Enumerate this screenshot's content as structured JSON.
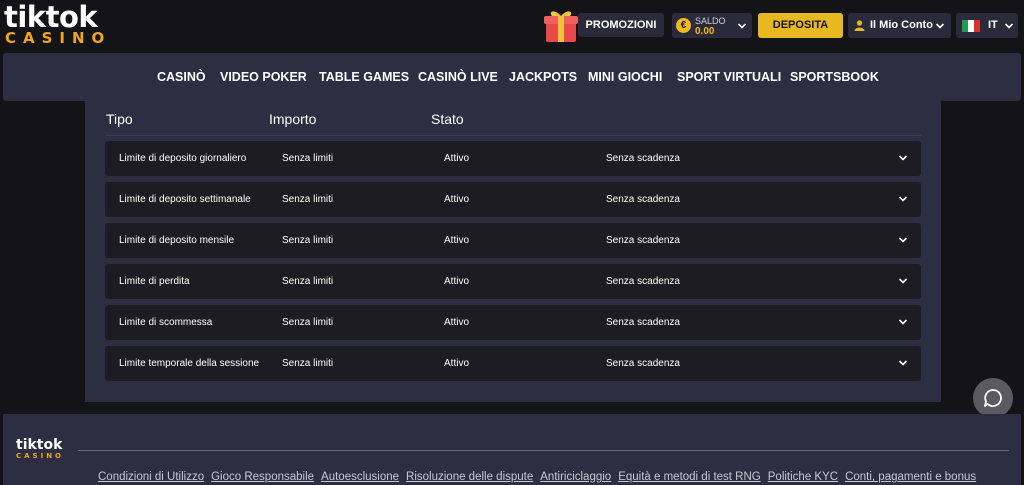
{
  "header": {
    "logo_top": "tiktok",
    "logo_bottom": "CASINO",
    "promo_label": "PROMOZIONI",
    "saldo_label": "SALDO",
    "saldo_value": "0.00",
    "deposit_label": "DEPOSITA",
    "account_label": "Il Mio Conto",
    "lang_label": "IT"
  },
  "nav": {
    "items": [
      "CASINÒ",
      "VIDEO POKER",
      "TABLE GAMES",
      "CASINÒ LIVE",
      "JACKPOTS",
      "MINI GIOCHI",
      "SPORT VIRTUALI",
      "SPORTSBOOK"
    ]
  },
  "limits": {
    "headers": [
      "Tipo",
      "Importo",
      "Stato"
    ],
    "rows": [
      {
        "tipo": "Limite di deposito giornaliero",
        "importo": "Senza limiti",
        "stato": "Attivo",
        "scadenza": "Senza scadenza"
      },
      {
        "tipo": "Limite di deposito settimanale",
        "importo": "Senza limiti",
        "stato": "Attivo",
        "scadenza": "Senza scadenza"
      },
      {
        "tipo": "Limite di deposito mensile",
        "importo": "Senza limiti",
        "stato": "Attivo",
        "scadenza": "Senza scadenza"
      },
      {
        "tipo": "Limite di perdita",
        "importo": "Senza limiti",
        "stato": "Attivo",
        "scadenza": "Senza scadenza"
      },
      {
        "tipo": "Limite di scommessa",
        "importo": "Senza limiti",
        "stato": "Attivo",
        "scadenza": "Senza scadenza"
      },
      {
        "tipo": "Limite temporale della sessione",
        "importo": "Senza limiti",
        "stato": "Attivo",
        "scadenza": "Senza scadenza"
      }
    ]
  },
  "footer": {
    "logo_top": "tiktok",
    "logo_bottom": "CASINO",
    "links": [
      "Condizioni di Utilizzo",
      "Gioco Responsabile",
      "Autoesclusione",
      "Risoluzione delle dispute",
      "Antiriciclaggio",
      "Equità e metodi di test RNG",
      "Politiche KYC",
      "Conti, pagamenti e bonus"
    ]
  },
  "colors": {
    "accent_yellow": "#e6b822",
    "logo_orange": "#f0a61c",
    "panel_bg": "#2e2e42",
    "page_bg": "#141418",
    "row_bg": "#1c1c22"
  },
  "icons": [
    "gift-icon",
    "coin-icon",
    "chevron-down-icon",
    "user-icon",
    "italy-flag-icon",
    "chat-icon"
  ]
}
